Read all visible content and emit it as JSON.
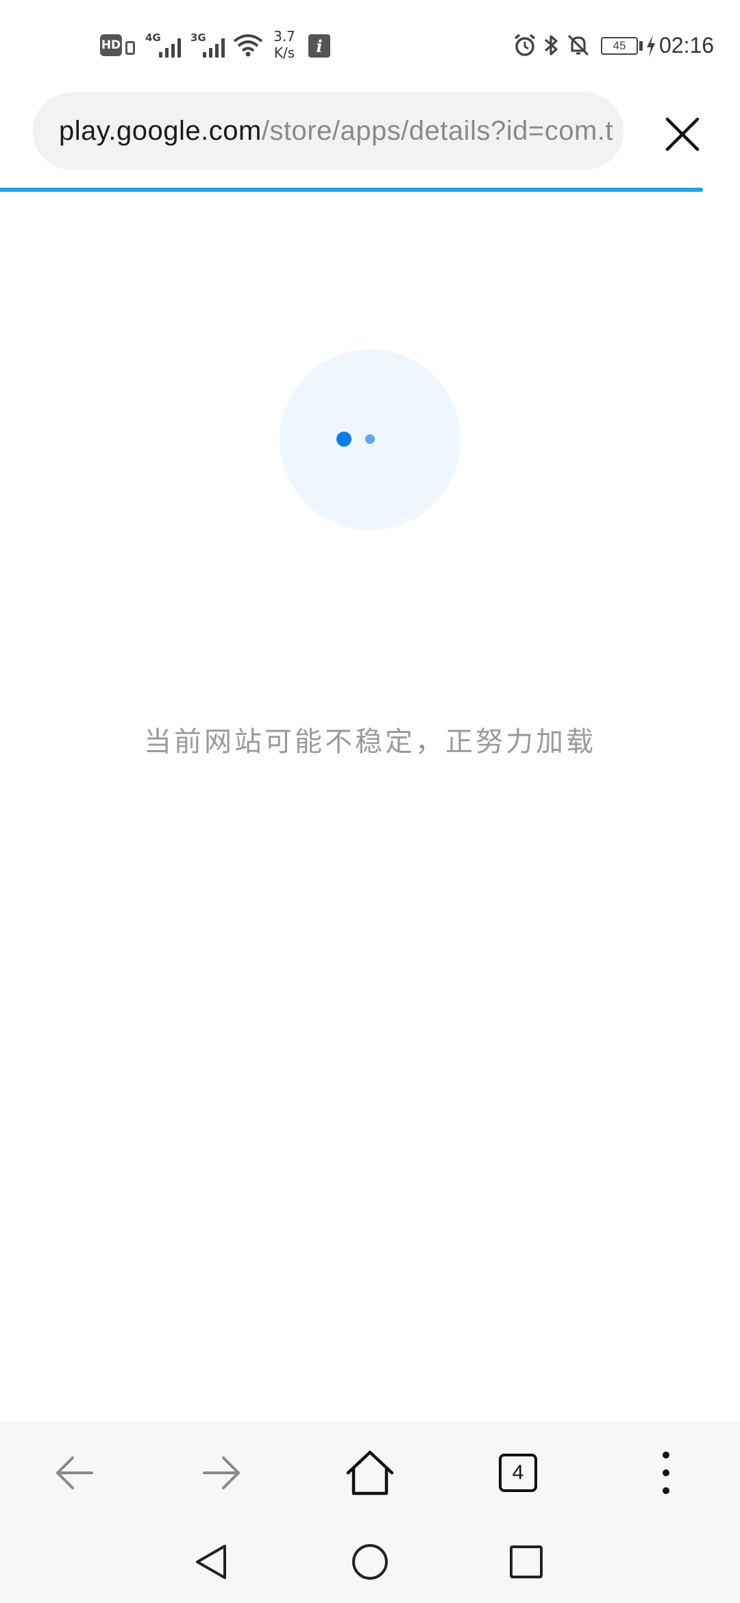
{
  "status_bar": {
    "hd_label": "HD",
    "network_1": "4G",
    "network_2": "3G",
    "speed_value": "3.7",
    "speed_unit": "K/s",
    "info_badge": "i",
    "battery_level": "45",
    "time": "02:16",
    "icons": [
      "signal-icon",
      "wifi-icon",
      "alarm-icon",
      "bluetooth-icon",
      "mute-icon",
      "charging-icon"
    ]
  },
  "address_bar": {
    "url_host": "play.google.com",
    "url_path": "/store/apps/details?id=com.t",
    "close_icon": "close-icon",
    "progress": 0.95,
    "accent_color": "#1aa5e6"
  },
  "loading": {
    "message": "当前网站可能不稳定，正努力加载",
    "dot_color": "#0d7ee6"
  },
  "toolbar": {
    "back_icon": "arrow-left-icon",
    "forward_icon": "arrow-right-icon",
    "home_icon": "home-icon",
    "tab_count": "4",
    "menu_icon": "more-vertical-icon"
  },
  "navbar": {
    "back_icon": "triangle-back-icon",
    "home_icon": "circle-home-icon",
    "recents_icon": "square-recents-icon"
  }
}
